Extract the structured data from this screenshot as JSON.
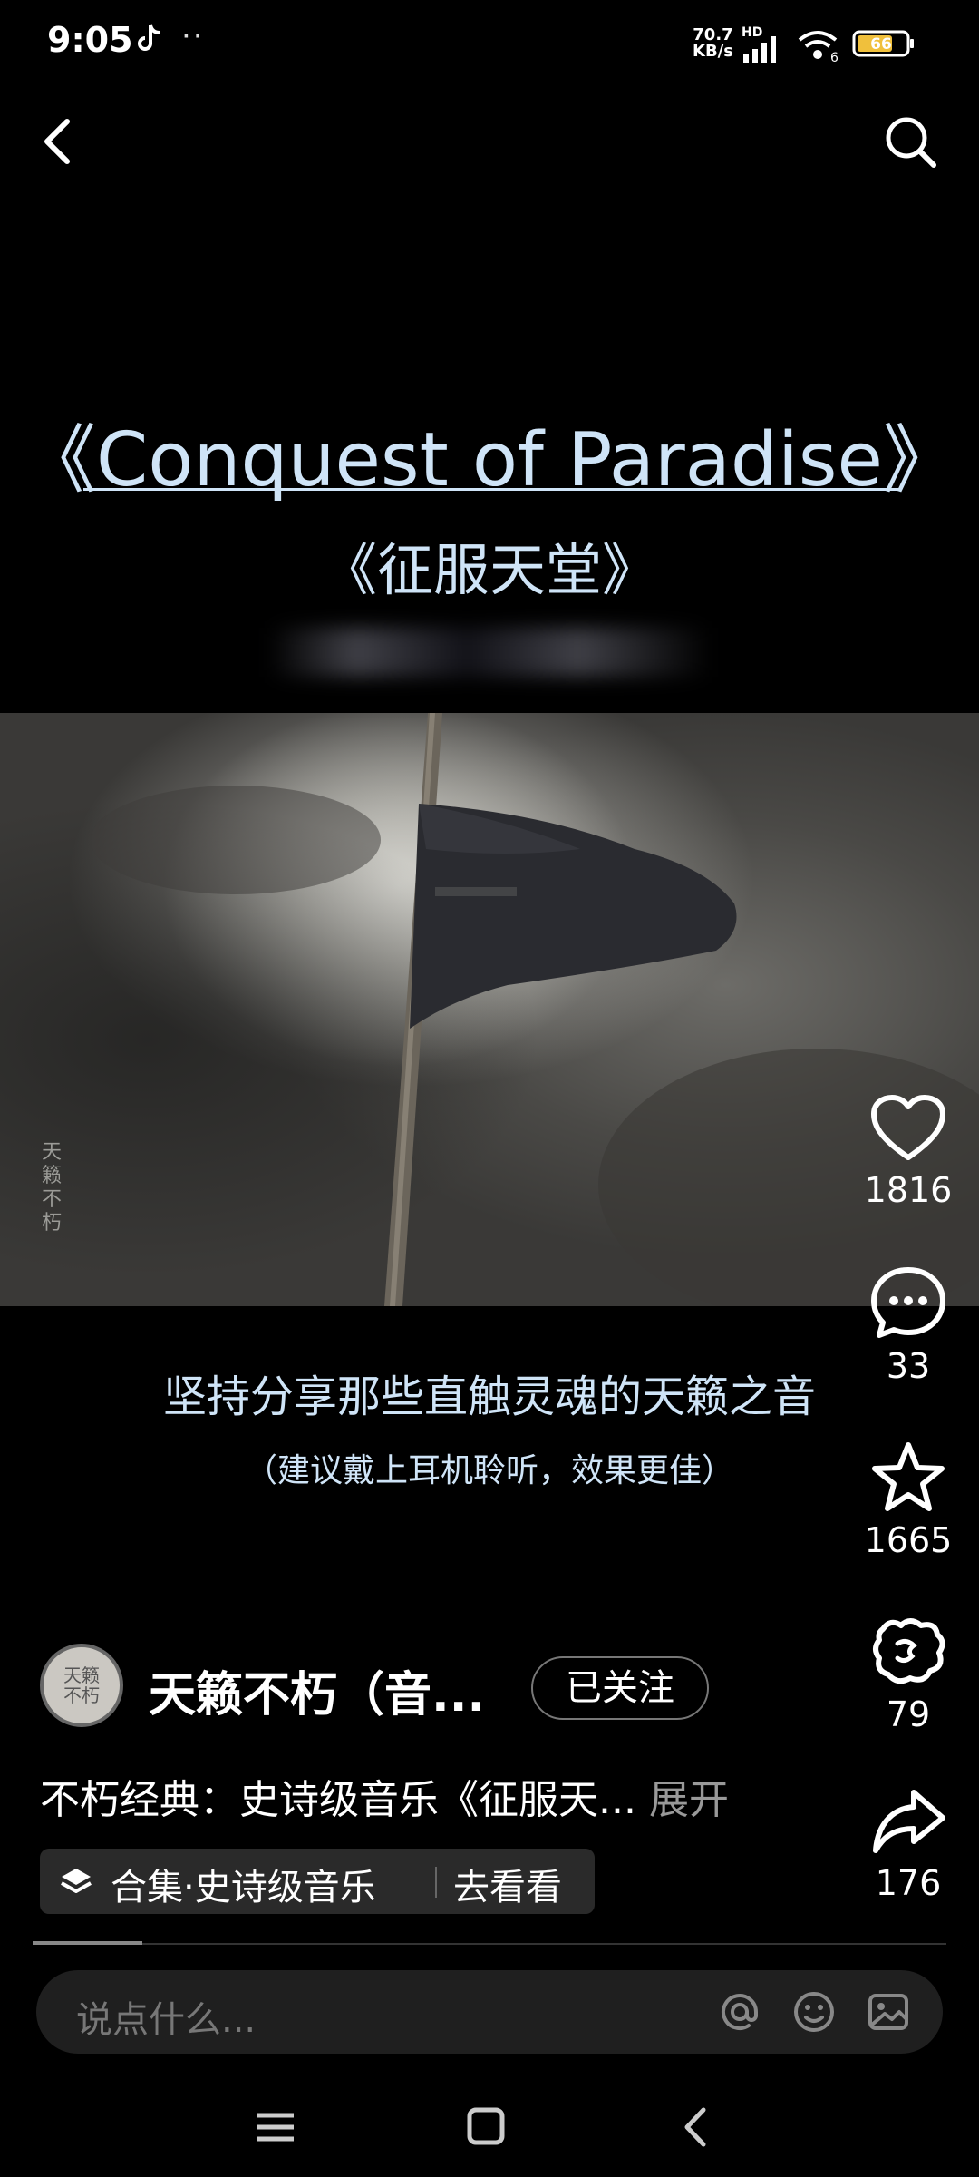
{
  "status_bar": {
    "time": "9:05",
    "dots": "··",
    "net_speed_value": "70.7",
    "net_speed_unit": "KB/s",
    "hd": "HD",
    "wifi_label": "6",
    "battery": "66"
  },
  "header": {
    "back_icon": "chevron-left-icon",
    "search_icon": "search-icon"
  },
  "video": {
    "title_en": "《Conquest of Paradise》",
    "title_cn": "《征服天堂》",
    "watermark": "天籁不朽",
    "subtitle_main": "坚持分享那些直触灵魂的天籁之音",
    "subtitle_note": "（建议戴上耳机聆听，效果更佳）",
    "progress_fraction": 0.12
  },
  "actions": {
    "like_count": "1816",
    "comment_count": "33",
    "favorite_count": "1665",
    "gift_count": "79",
    "share_count": "176"
  },
  "author": {
    "avatar_text": "天籁不朽",
    "name": "天籁不朽（音...",
    "follow_label": "已关注"
  },
  "description": {
    "text": "不朽经典：史诗级音乐《征服天...",
    "expand_label": "展开"
  },
  "collection": {
    "label": "合集·史诗级音乐",
    "go_label": "去看看"
  },
  "comment_input": {
    "placeholder": "说点什么..."
  },
  "colors": {
    "accent_text": "#cfe4f7",
    "background": "#000000",
    "battery_fill": "#f0c03c"
  }
}
